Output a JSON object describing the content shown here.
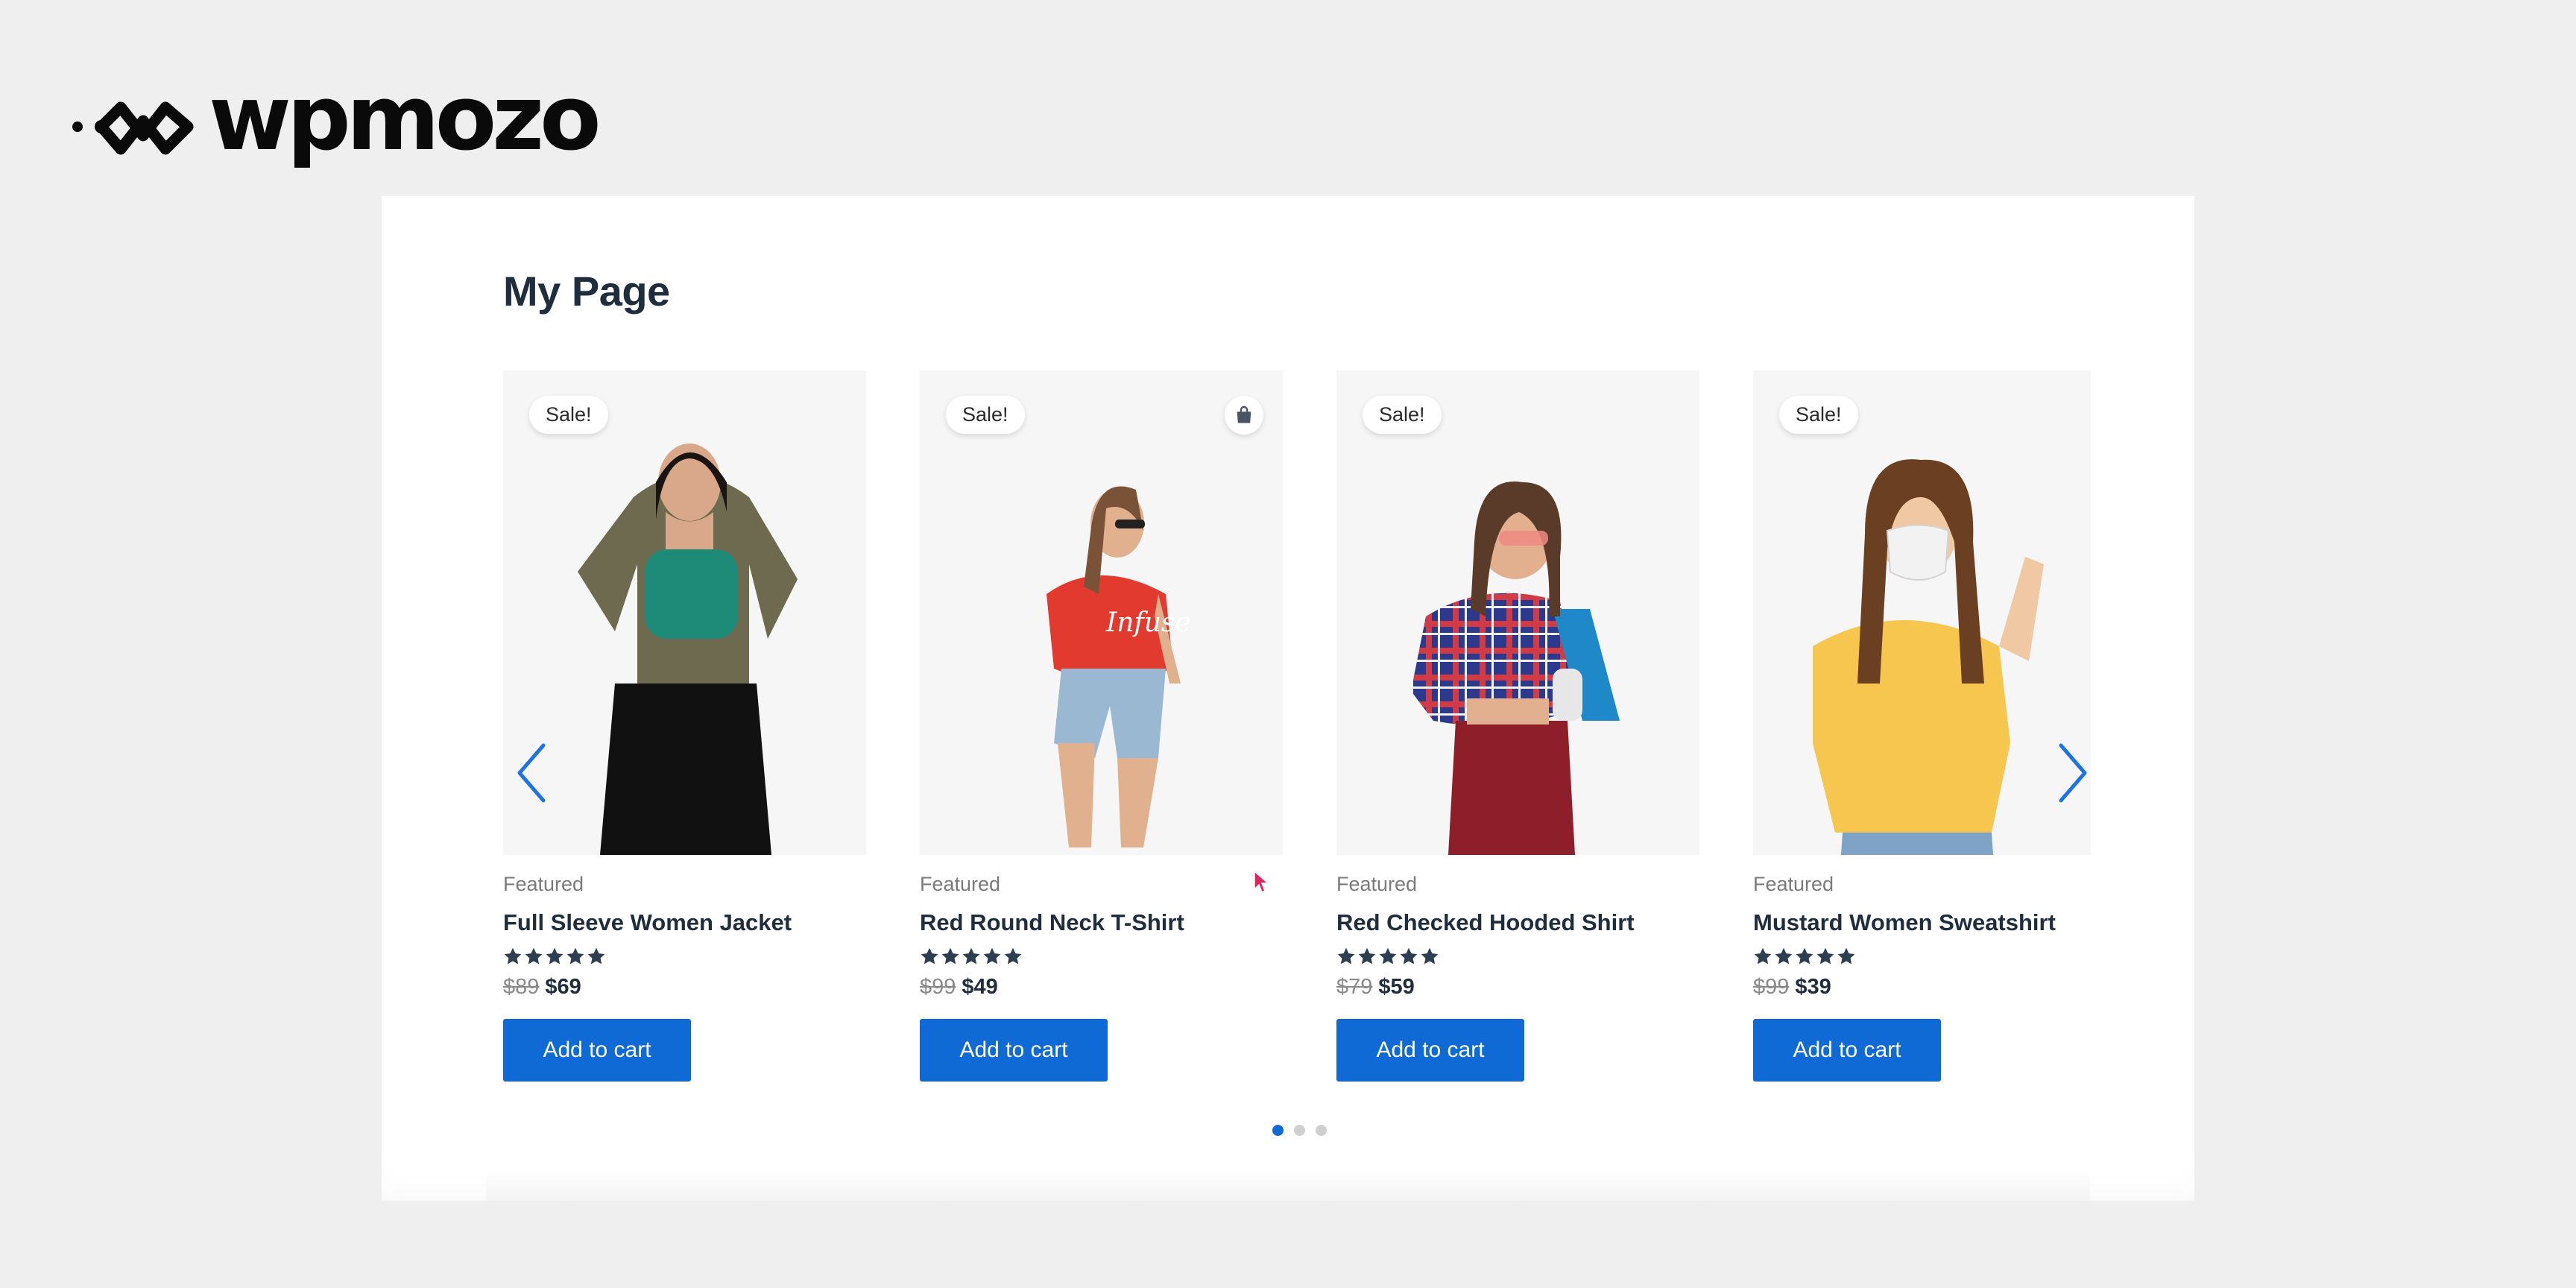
{
  "brand": {
    "name": "wpmozo"
  },
  "page": {
    "title": "My Page"
  },
  "carousel": {
    "products": [
      {
        "badge": "Sale!",
        "category": "Featured",
        "name": "Full Sleeve Women Jacket",
        "rating": 5,
        "old_price": "$89",
        "price": "$69",
        "cta": "Add to cart"
      },
      {
        "badge": "Sale!",
        "category": "Featured",
        "name": "Red Round Neck T-Shirt",
        "rating": 5,
        "old_price": "$99",
        "price": "$49",
        "cta": "Add to cart"
      },
      {
        "badge": "Sale!",
        "category": "Featured",
        "name": "Red Checked Hooded Shirt",
        "rating": 5,
        "old_price": "$79",
        "price": "$59",
        "cta": "Add to cart"
      },
      {
        "badge": "Sale!",
        "category": "Featured",
        "name": "Mustard Women Sweatshirt",
        "rating": 5,
        "old_price": "$99",
        "price": "$39",
        "cta": "Add to cart"
      }
    ],
    "prev_icon": "chevron-left-icon",
    "next_icon": "chevron-right-icon",
    "pagination": {
      "pages": 3,
      "active": 1
    }
  },
  "colors": {
    "accent": "#0f6ad6",
    "text": "#1f2d3d",
    "background": "#efefef"
  }
}
